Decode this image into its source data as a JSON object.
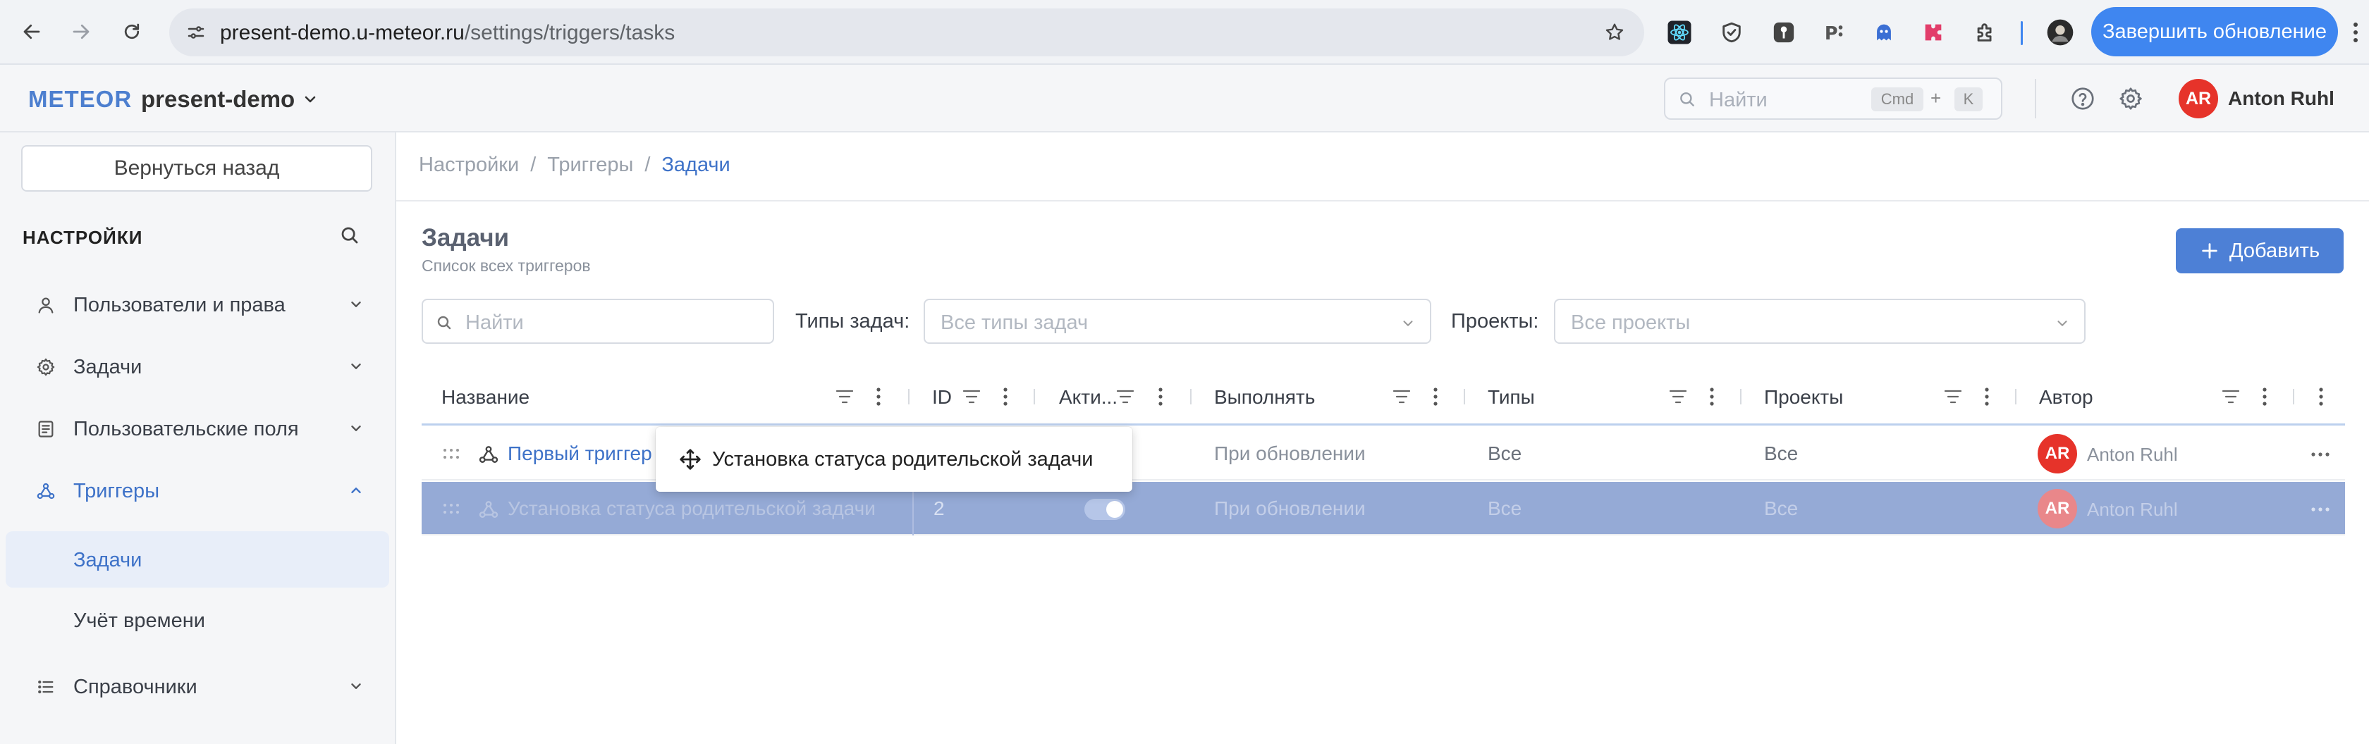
{
  "browser": {
    "url_host": "present-demo.u-meteor.ru",
    "url_path": "/settings/triggers/tasks",
    "update_button": "Завершить обновление",
    "extensions": [
      "react-devtools-icon",
      "shield-icon",
      "password-icon",
      "pricing-icon",
      "ghost-icon",
      "puzzle-pink-icon",
      "extensions-icon",
      "profile-icon"
    ]
  },
  "header": {
    "brand": "METEOR",
    "workspace": "present-demo",
    "search_placeholder": "Найти",
    "shortcut_cmd": "Cmd",
    "shortcut_plus": "+",
    "shortcut_key": "K",
    "user_initials": "AR",
    "user_name": "Anton Ruhl"
  },
  "sidebar": {
    "back_button": "Вернуться назад",
    "title": "НАСТРОЙКИ",
    "items": [
      {
        "label": "Пользователи и права",
        "icon": "user-icon",
        "expanded": false
      },
      {
        "label": "Задачи",
        "icon": "gear-icon",
        "expanded": false
      },
      {
        "label": "Пользовательские поля",
        "icon": "form-icon",
        "expanded": false
      },
      {
        "label": "Триггеры",
        "icon": "trigger-icon",
        "expanded": true,
        "active": true
      },
      {
        "label": "Справочники",
        "icon": "list-icon",
        "expanded": false
      }
    ],
    "subitems": [
      {
        "label": "Задачи",
        "active": true
      },
      {
        "label": "Учёт времени",
        "active": false
      }
    ]
  },
  "breadcrumb": [
    "Настройки",
    "/",
    "Триггеры",
    "/",
    "Задачи"
  ],
  "page": {
    "title": "Задачи",
    "subtitle": "Список всех триггеров",
    "add_button": "Добавить"
  },
  "filters": {
    "search_placeholder": "Найти",
    "task_types_label": "Типы задач",
    "task_types_colon": ":",
    "task_types_placeholder": "Все типы задач",
    "projects_label": "Проекты",
    "projects_colon": ":",
    "projects_placeholder": "Все проекты"
  },
  "table": {
    "columns": [
      "Название",
      "ID",
      "Акти...",
      "Выполнять",
      "Типы",
      "Проекты",
      "Автор"
    ],
    "rows": [
      {
        "name": "Первый триггер",
        "id": "",
        "active": true,
        "run": "При обновлении",
        "types": "Все",
        "projects": "Все",
        "author_initials": "AR",
        "author": "Anton Ruhl"
      },
      {
        "name": "Установка статуса родительской задачи",
        "id": "2",
        "active": true,
        "run": "При обновлении",
        "types": "Все",
        "projects": "Все",
        "author_initials": "AR",
        "author": "Anton Ruhl",
        "selected": true
      }
    ]
  },
  "drag_tooltip": {
    "label": "Установка статуса родительской задачи",
    "icon": "move-icon"
  },
  "colors": {
    "accent": "#4d80d6",
    "selected_row": "#95aad6",
    "avatar": "#e6332a",
    "browser_update": "#3f86f0"
  }
}
